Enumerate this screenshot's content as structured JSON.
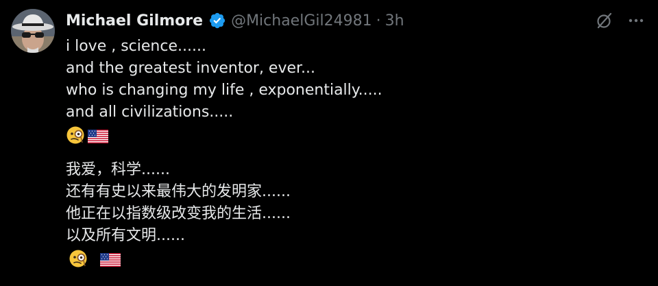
{
  "tweet": {
    "display_name": "Michael Gilmore",
    "handle": "@MichaelGil24981",
    "separator": "·",
    "time": "3h",
    "verified_badge": "verified-icon",
    "colors": {
      "background": "#000000",
      "text": "#e7e9ea",
      "secondary": "#71767b",
      "verified": "#1d9bf0"
    },
    "lines_en": [
      "i love , science......",
      "and the greatest inventor, ever...",
      "who is changing my life , exponentially.....",
      "and all civilizations....."
    ],
    "lines_zh": [
      "我爱，科学......",
      "还有有史以来最伟大的发明家......",
      "他正在以指数级改变我的生活......",
      "以及所有文明......"
    ],
    "emojis": [
      "face-with-monocle-icon",
      "us-flag-icon"
    ],
    "actions": [
      "grok-icon",
      "more-options-icon"
    ]
  }
}
